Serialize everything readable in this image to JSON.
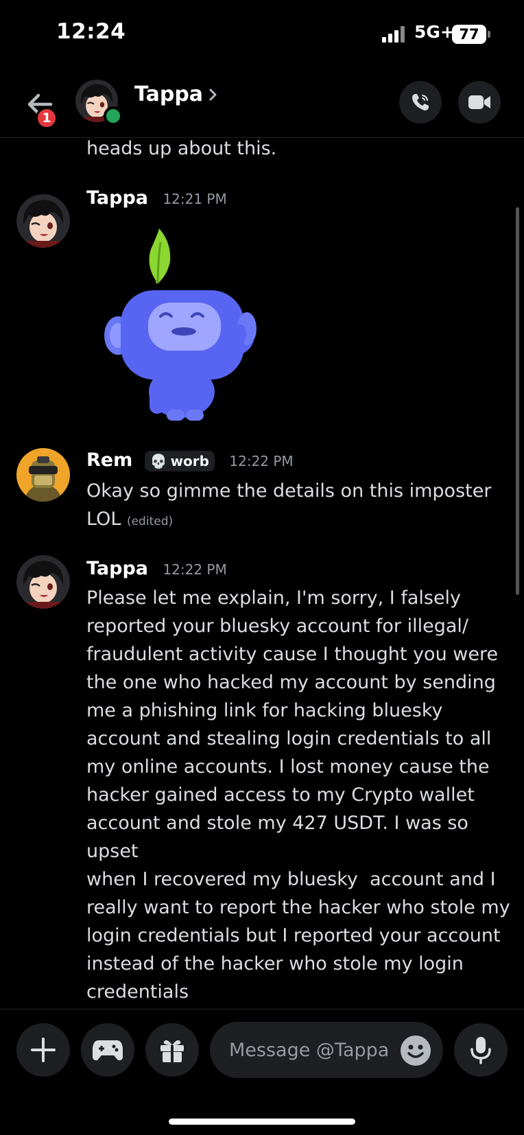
{
  "status_bar": {
    "time": "12:24",
    "network": "5G+",
    "battery": "77"
  },
  "header": {
    "title": "Tappa",
    "unread_badge": "1"
  },
  "previous_message_tail": "heads up about this.",
  "messages": [
    {
      "author": "Tappa",
      "time": "12:21 PM",
      "sticker": "wumpus-waving-sticker"
    },
    {
      "author": "Rem",
      "tag": "worb",
      "time": "12:22 PM",
      "text": "Okay so gimme the details on this imposter LOL",
      "edited": "(edited)"
    },
    {
      "author": "Tappa",
      "time": "12:22 PM",
      "lines": [
        "Please let me explain, I'm sorry, I falsely",
        "reported your bluesky account for illegal/",
        "fraudulent activity cause I thought you were",
        "the one who hacked my account by sending",
        "me a phishing link for hacking bluesky",
        "account and stealing login credentials to all",
        "my online accounts. I lost money cause the",
        "hacker gained access to my Crypto wallet",
        "account and stole my 427 USDT. I was so upset",
        "when I recovered my bluesky  account and I",
        "really want to report the hacker who stole my",
        "login credentials but I reported your account",
        "instead of the hacker who stole my login",
        "credentials"
      ]
    }
  ],
  "composer": {
    "placeholder": "Message @Tappa"
  },
  "colors": {
    "background": "#000000",
    "surface": "#1e1f22",
    "online": "#23a55a",
    "badge": "#e5373e",
    "blurple": "#5865f2",
    "leaf": "#8bd630"
  }
}
